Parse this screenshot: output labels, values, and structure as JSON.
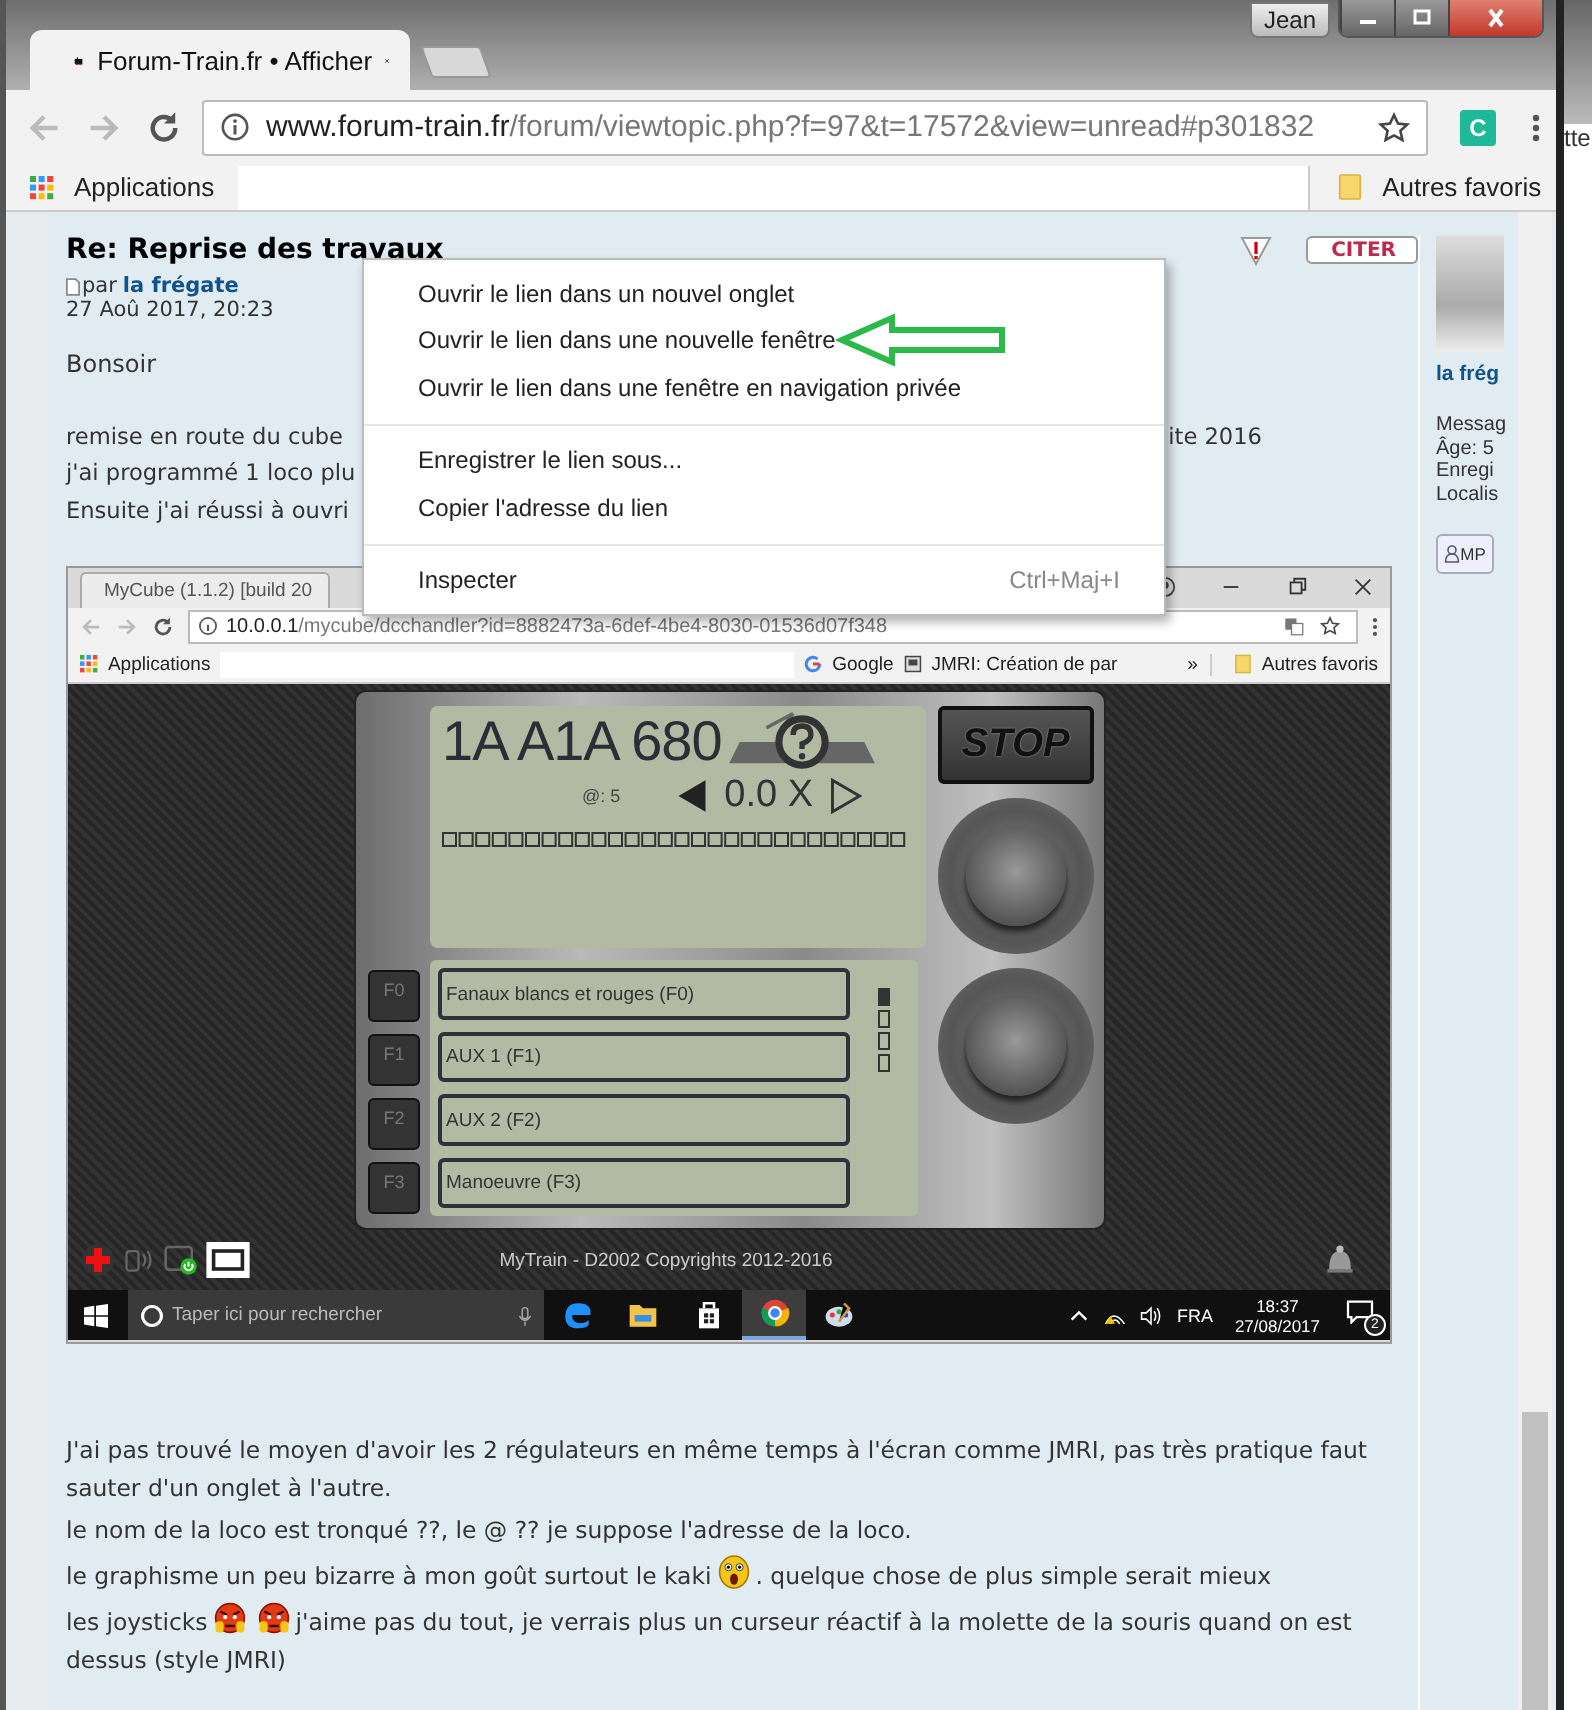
{
  "window": {
    "user": "Jean"
  },
  "tabs": [
    {
      "title": "Forum-Train.fr • Afficher",
      "selected": true
    }
  ],
  "address_bar": {
    "domain": "www.forum-train.fr",
    "path": "/forum/viewtopic.php?f=97&t=17572&view=unread#p301832"
  },
  "extension": {
    "label": "C"
  },
  "bookmarks": {
    "apps": "Applications",
    "other": "Autres favoris"
  },
  "background_window": {
    "text": "tte"
  },
  "post": {
    "title": "Re: Reprise des travaux",
    "by": "par",
    "author": "la frégate",
    "date": "27 Aoû 2017, 20:23",
    "quote_button": "CITER",
    "greeting": "Bonsoir",
    "covered_lines": [
      {
        "left": "remise en route du cube",
        "right": "ite 2016"
      },
      {
        "left": "j'ai programmé 1 loco plu"
      },
      {
        "left": "Ensuite j'ai réussi à ouvri"
      }
    ],
    "paragraphs": [
      {
        "segments": [
          {
            "kind": "line",
            "text": "J'ai pas trouvé le moyen d'avoir les 2 régulateurs en même temps à l'écran comme JMRI, pas très pratique faut"
          },
          {
            "kind": "line",
            "text": "sauter d'un onglet à l'autre."
          }
        ]
      },
      {
        "segments": [
          {
            "kind": "text",
            "text": "le nom de la loco est tronqué ??, le @ ?? je suppose l'adresse de la loco."
          }
        ]
      },
      {
        "segments": [
          {
            "kind": "text",
            "text": "le graphisme un peu bizarre à mon goût surtout le kaki"
          },
          {
            "kind": "shocked"
          },
          {
            "kind": "text",
            "text": ". quelque chose de plus simple serait mieux"
          }
        ]
      },
      {
        "segments": [
          {
            "kind": "text",
            "text": "les joysticks"
          },
          {
            "kind": "angry"
          },
          {
            "kind": "angry"
          },
          {
            "kind": "text",
            "text": "j'aime pas du tout, je verrais plus un curseur réactif à la molette de la souris quand on est"
          },
          {
            "kind": "line",
            "text": "dessus (style JMRI)"
          }
        ]
      }
    ]
  },
  "profile": {
    "name": "la frég",
    "fields": [
      "Messag",
      "Âge: 5",
      "Enregi",
      "Localis"
    ],
    "pm_button": "MP"
  },
  "context_menu": {
    "groups": [
      [
        {
          "label": "Ouvrir le lien dans un nouvel onglet"
        },
        {
          "label": "Ouvrir le lien dans une nouvelle fenêtre"
        },
        {
          "label": "Ouvrir le lien dans une fenêtre en navigation privée"
        }
      ],
      [
        {
          "label": "Enregistrer le lien sous..."
        },
        {
          "label": "Copier l'adresse du lien"
        }
      ],
      [
        {
          "label": "Inspecter",
          "shortcut": "Ctrl+Maj+I"
        }
      ]
    ]
  },
  "embedded_screenshot": {
    "tabs": [
      {
        "title": "MyCube (1.1.2) [build 20",
        "selected": true
      }
    ],
    "address": {
      "host": "10.0.0.1",
      "path": "/mycube/dcchandler?id=8882473a-6def-4be4-8030-01536d07f348"
    },
    "bookmarks": [
      {
        "kind": "apps",
        "label": "Applications"
      },
      {
        "kind": "google",
        "label": "Google"
      },
      {
        "kind": "page",
        "label": "JMRI: Création de par"
      }
    ],
    "more": "»",
    "other": "Autres favoris",
    "throttle": {
      "loco_name": "1A A1A 680",
      "address": "@: 5",
      "speed": "0.0 X",
      "stop": "STOP",
      "functions": [
        {
          "key": "F0",
          "label": "Fanaux blancs et rouges (F0)"
        },
        {
          "key": "F1",
          "label": "AUX 1 (F1)"
        },
        {
          "key": "F2",
          "label": "AUX 2 (F2)"
        },
        {
          "key": "F3",
          "label": "Manoeuvre (F3)"
        }
      ],
      "pages": [
        {
          "selected": true
        },
        {
          "selected": false
        },
        {
          "selected": false
        },
        {
          "selected": false
        }
      ]
    },
    "footer": "MyTrain - D2002 Copyrights 2012-2016",
    "taskbar": {
      "search_placeholder": "Taper ici pour rechercher",
      "language": "FRA",
      "time": "18:37",
      "date": "27/08/2017",
      "notifications": "2"
    }
  }
}
